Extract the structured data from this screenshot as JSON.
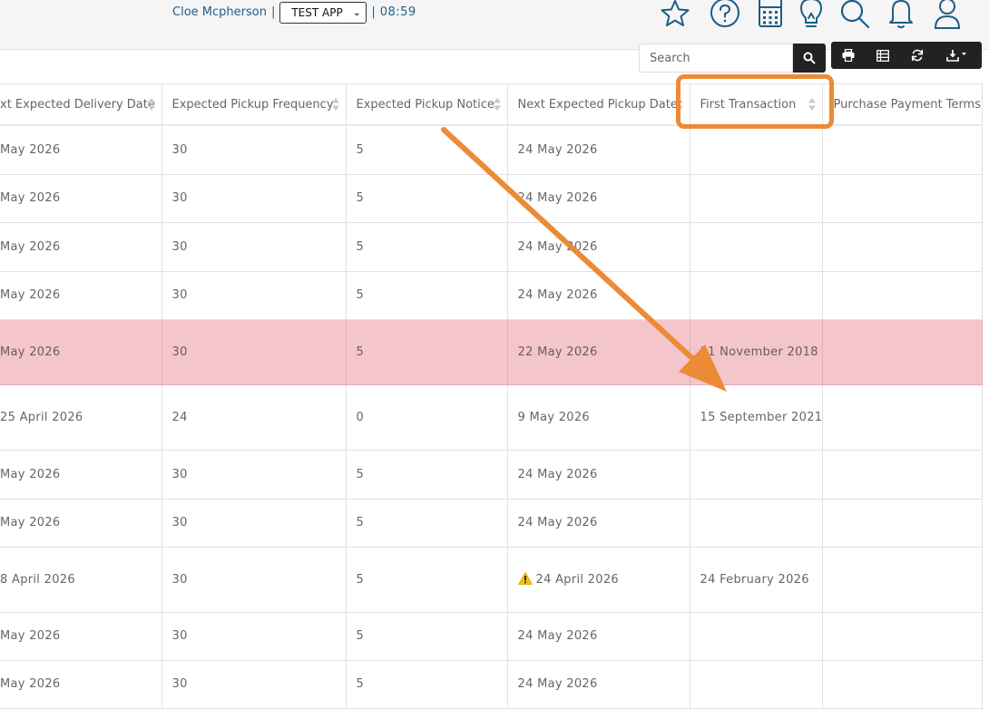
{
  "header": {
    "user_name": "Cloe Mcpherson",
    "separator": "|",
    "app_selected": "TEST APP",
    "clock": "08:59",
    "icons": [
      "star-icon",
      "help-icon",
      "calculator-icon",
      "lightbulb-icon",
      "search-icon",
      "bell-icon",
      "user-icon"
    ]
  },
  "toolbar": {
    "search_placeholder": "Search",
    "buttons": [
      "print-icon",
      "columns-icon",
      "refresh-icon",
      "download-icon"
    ]
  },
  "table": {
    "columns": [
      "xt Expected Delivery Date",
      "Expected Pickup Frequency",
      "Expected Pickup Notice",
      "Next Expected Pickup Date",
      "First Transaction",
      "Purchase Payment Terms"
    ],
    "rows": [
      [
        "May 2026",
        "30",
        "5",
        "24 May 2026",
        "",
        ""
      ],
      [
        "May 2026",
        "30",
        "5",
        "24 May 2026",
        "",
        ""
      ],
      [
        "May 2026",
        "30",
        "5",
        "24 May 2026",
        "",
        ""
      ],
      [
        "May 2026",
        "30",
        "5",
        "24 May 2026",
        "",
        ""
      ],
      [
        "May 2026",
        "30",
        "5",
        "22 May 2026",
        "11 November 2018",
        ""
      ],
      [
        "25 April 2026",
        "24",
        "0",
        "9 May 2026",
        "15 September 2021",
        ""
      ],
      [
        "May 2026",
        "30",
        "5",
        "24 May 2026",
        "",
        ""
      ],
      [
        "May 2026",
        "30",
        "5",
        "24 May 2026",
        "",
        ""
      ],
      [
        "8 April 2026",
        "30",
        "5",
        "24 April 2026",
        "24 February 2026",
        ""
      ],
      [
        "May 2026",
        "30",
        "5",
        "24 May 2026",
        "",
        ""
      ],
      [
        "May 2026",
        "30",
        "5",
        "24 May 2026",
        "",
        ""
      ]
    ],
    "highlighted_row": 4,
    "warning_row": 8,
    "warning_icon": "warning-icon"
  },
  "colors": {
    "header_bg": "#f5f5f5",
    "link_blue": "#1f5f8b",
    "icon_blue": "#1d5c86",
    "highlight_row": "#f4c6cc",
    "annotation_orange": "#ec8b36",
    "toolbar_dark": "#222222"
  }
}
